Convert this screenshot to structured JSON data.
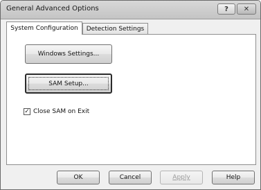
{
  "window": {
    "title": "General Advanced Options",
    "help_glyph": "?",
    "close_glyph": "✕"
  },
  "tabs": [
    {
      "label": "System Configuration",
      "active": true
    },
    {
      "label": "Detection Settings",
      "active": false
    }
  ],
  "panel": {
    "windows_settings_label": "Windows Settings...",
    "sam_setup_label": "SAM Setup...",
    "close_sam_label": "Close SAM on Exit",
    "close_sam_checked": true,
    "check_glyph": "✓"
  },
  "footer": {
    "ok_label": "OK",
    "cancel_label": "Cancel",
    "apply_label": "Apply",
    "help_label": "Help"
  }
}
